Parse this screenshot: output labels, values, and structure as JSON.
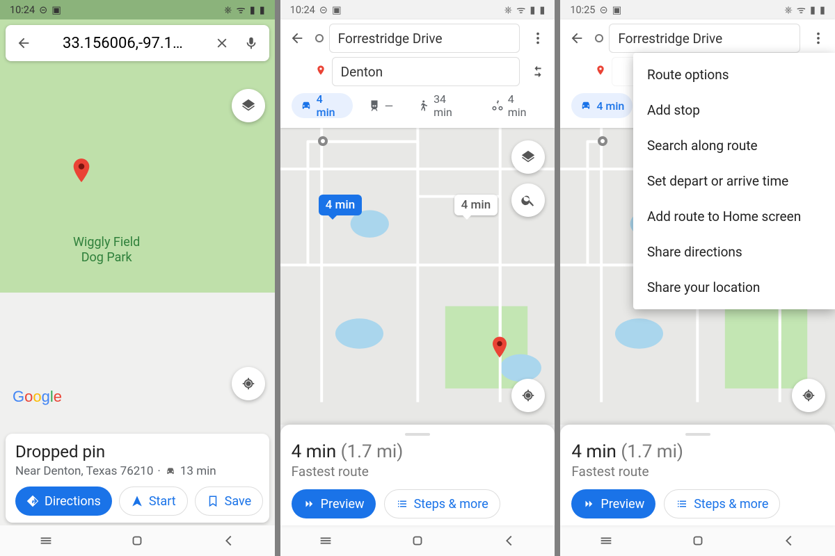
{
  "s1": {
    "status_time": "10:24",
    "search_value": "33.156006,-97.1…",
    "park_line1": "Wiggly Field",
    "park_line2": "Dog Park",
    "card": {
      "title": "Dropped pin",
      "near": "Near Denton, Texas 76210",
      "drive": "13 min"
    },
    "buttons": {
      "directions": "Directions",
      "start": "Start",
      "save": "Save"
    }
  },
  "s2": {
    "status_time": "10:24",
    "from": "Forrestridge Drive",
    "to": "Denton",
    "modes": {
      "drive": "4 min",
      "transit": "—",
      "walk": "34 min",
      "bike": "4 min"
    },
    "primary_badge": "4 min",
    "alt_badge": "4 min",
    "card": {
      "time": "4 min",
      "dist": "(1.7 mi)",
      "sub": "Fastest route"
    },
    "buttons": {
      "preview": "Preview",
      "steps": "Steps & more"
    }
  },
  "s3": {
    "status_time": "10:25",
    "from": "Forrestridge Drive",
    "modes": {
      "drive": "4 min"
    },
    "menu": [
      "Route options",
      "Add stop",
      "Search along route",
      "Set depart or arrive time",
      "Add route to Home screen",
      "Share directions",
      "Share your location"
    ],
    "card": {
      "time": "4 min",
      "dist": "(1.7 mi)",
      "sub": "Fastest route"
    },
    "buttons": {
      "preview": "Preview",
      "steps": "Steps & more"
    }
  }
}
